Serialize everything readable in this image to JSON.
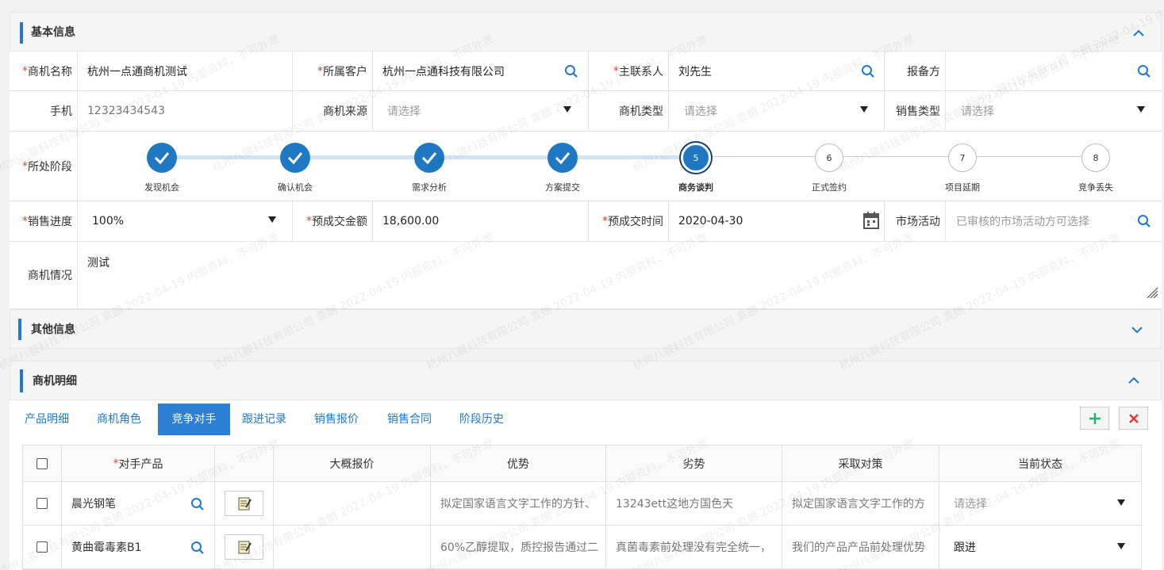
{
  "sections": {
    "basic": "基本信息",
    "other": "其他信息",
    "detail": "商机明细"
  },
  "fields": {
    "opp_name": {
      "label": "商机名称",
      "value": "杭州一点通商机测试"
    },
    "customer": {
      "label": "所属客户",
      "value": "杭州一点通科技有限公司"
    },
    "contact": {
      "label": "主联系人",
      "value": "刘先生"
    },
    "reporter": {
      "label": "报备方",
      "value": ""
    },
    "phone": {
      "label": "手机",
      "value": "12323434543"
    },
    "source": {
      "label": "商机来源",
      "placeholder": "请选择"
    },
    "opp_type": {
      "label": "商机类型",
      "placeholder": "请选择"
    },
    "sales_type": {
      "label": "销售类型",
      "placeholder": "请选择"
    },
    "stage": {
      "label": "所处阶段"
    },
    "progress": {
      "label": "销售进度",
      "value": "100%"
    },
    "amount": {
      "label": "预成交金额",
      "value": "18,600.00"
    },
    "deal_date": {
      "label": "预成交时间",
      "value": "2020-04-30"
    },
    "market": {
      "label": "市场活动",
      "placeholder": "已审核的市场活动方可选择"
    },
    "situation": {
      "label": "商机情况",
      "value": "测试"
    }
  },
  "stages": [
    {
      "num": "1",
      "label": "发现机会",
      "status": "done"
    },
    {
      "num": "2",
      "label": "确认机会",
      "status": "done"
    },
    {
      "num": "3",
      "label": "需求分析",
      "status": "done"
    },
    {
      "num": "4",
      "label": "方案提交",
      "status": "done"
    },
    {
      "num": "5",
      "label": "商务谈判",
      "status": "current"
    },
    {
      "num": "6",
      "label": "正式签约",
      "status": "todo"
    },
    {
      "num": "7",
      "label": "项目延期",
      "status": "todo"
    },
    {
      "num": "8",
      "label": "竞争丢失",
      "status": "todo"
    }
  ],
  "tabs": [
    "产品明细",
    "商机角色",
    "竞争对手",
    "跟进记录",
    "销售报价",
    "销售合同",
    "阶段历史"
  ],
  "active_tab": "竞争对手",
  "table": {
    "headers": [
      "对手产品",
      "",
      "大概报价",
      "优势",
      "劣势",
      "采取对策",
      "当前状态"
    ],
    "rows": [
      {
        "product": "晨光钢笔",
        "price": "",
        "advantage": "拟定国家语言文字工作的方针、",
        "disadvantage": "13243ett这地方国色天",
        "strategy": "拟定国家语言文字工作的方",
        "status": "请选择"
      },
      {
        "product": "黄曲霉毒素B1",
        "price": "",
        "advantage": "60%乙醇提取，质控报告通过二",
        "disadvantage": "真菌毒素前处理没有完全统一，",
        "strategy": "我们的产品产品前处理优势",
        "status": "跟进"
      }
    ]
  },
  "watermark": "杭州八骏科技有限公司 袁朗 2022-04-19 内部资料，不可外泄",
  "colors": {
    "accent": "#1f78d1",
    "required": "#e0442a",
    "add": "#21b573",
    "delete": "#e03b3b"
  }
}
